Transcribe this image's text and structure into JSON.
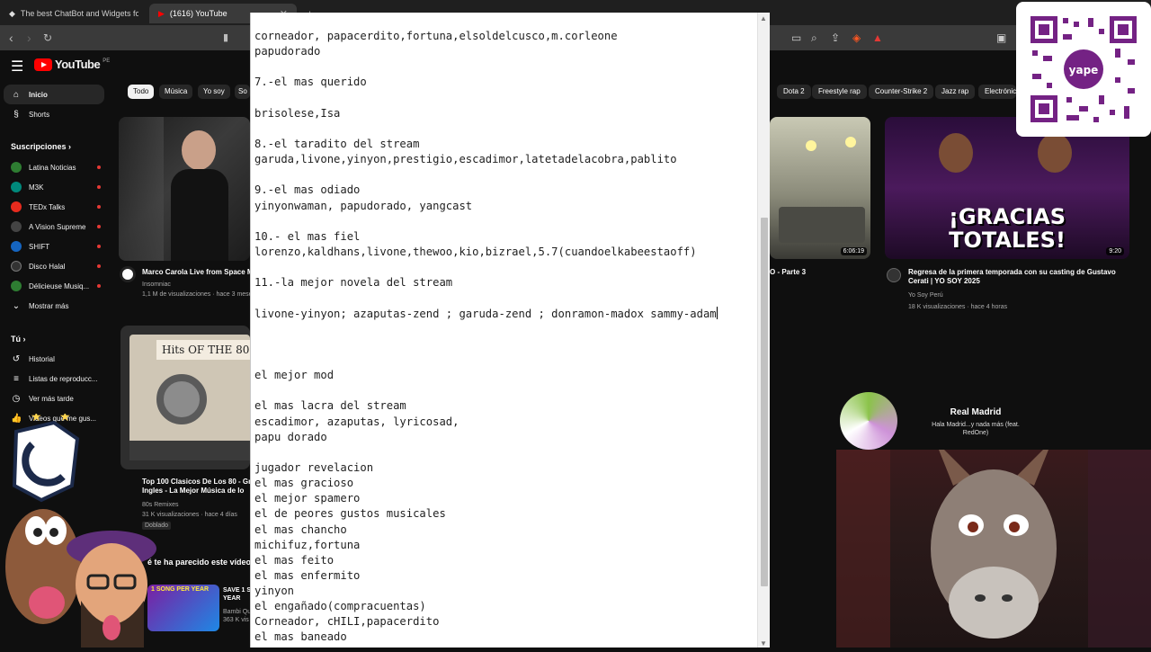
{
  "browser": {
    "tabs": [
      {
        "title": "The best ChatBot and Widgets for Ki",
        "active": false
      },
      {
        "title": "(1616) YouTube",
        "active": true
      }
    ],
    "new_tab": "+"
  },
  "youtube": {
    "logo_text": "YouTube",
    "logo_country": "PE",
    "sidebar": {
      "main": [
        {
          "label": "Inicio",
          "icon": "home-icon",
          "active": true
        },
        {
          "label": "Shorts",
          "icon": "shorts-icon",
          "active": false
        }
      ],
      "subscriptions_title": "Suscripciones",
      "subscriptions": [
        {
          "label": "Latina Noticias",
          "color": "#2e7d32"
        },
        {
          "label": "M3K",
          "color": "#00897b"
        },
        {
          "label": "TEDx Talks",
          "color": "#e62b1e"
        },
        {
          "label": "A Vision Supreme",
          "color": "#444444"
        },
        {
          "label": "SHIFT",
          "color": "#1565c0"
        },
        {
          "label": "Disco Halal",
          "color": "#333333"
        },
        {
          "label": "Délicieuse Musiq...",
          "color": "#2e7d32"
        }
      ],
      "show_more": "Mostrar más",
      "you_title": "Tú",
      "you_items": [
        {
          "label": "Historial",
          "icon": "history-icon"
        },
        {
          "label": "Listas de reproducc...",
          "icon": "playlist-icon"
        },
        {
          "label": "Ver más tarde",
          "icon": "clock-icon"
        },
        {
          "label": "Videos que me gus...",
          "icon": "thumbs-up-icon"
        }
      ]
    },
    "chips_left": [
      "Todo",
      "Música",
      "Yo soy",
      "So"
    ],
    "chips_right": [
      "Dota 2",
      "Freestyle rap",
      "Counter-Strike 2",
      "Jazz rap",
      "Electrónic"
    ],
    "videos": [
      {
        "title": "Marco Carola Live from Space M",
        "channel": "Insomniac",
        "meta": "1,1 M de visualizaciones · hace 3 meses"
      },
      {
        "title": "Top 100 Clasicos De Los 80 - Gr\nIngles - La Mejor Música de lo",
        "channel": "80s Remixes",
        "meta": "31 K visualizaciones · hace 4 días",
        "badge": "Doblado"
      },
      {
        "title": "é te ha parecido este vídeo",
        "channel": "",
        "meta": ""
      },
      {
        "title": "O - Parte 3",
        "channel": "",
        "meta": "",
        "duration": "6:06:19"
      },
      {
        "title": "Regresa de la primera temporada con su casting de Gustavo\nCerati | YO SOY 2025",
        "channel": "Yo Soy Perú",
        "meta": "18 K visualizaciones · hace 4 horas",
        "duration": "9:20",
        "overlay_text": "¡GRACIAS\nTOTALES!"
      }
    ],
    "song_card": {
      "label": "1 SONG PER YEAR",
      "sub": "SAVE 1 S\nYEAR",
      "meta": "Bambi Qui\n363 K vis"
    },
    "cassette_label": "Hits OF THE 80"
  },
  "editor": {
    "lines": [
      "corneador, papacerdito,fortuna,elsoldelcusco,m.corleone",
      "papudorado",
      "",
      "7.-el mas querido",
      "",
      "brisolese,Isa",
      "",
      "8.-el taradito del stream",
      "garuda,livone,yinyon,prestigio,escadimor,latetadelacobra,pablito",
      "",
      "9.-el mas odiado",
      "yinyonwaman, papudorado, yangcast",
      "",
      "10.- el mas fiel",
      "lorenzo,kaldhans,livone,thewoo,kio,bizrael,5.7(cuandoelkabeestaoff)",
      "",
      "11.-la mejor novela del stream",
      "",
      "livone-yinyon; azaputas-zend ; garuda-zend ; donramon-madox sammy-adam",
      "",
      "",
      "",
      "el mejor mod",
      "",
      "el mas lacra del stream",
      "escadimor, azaputas, lyricosad,",
      "papu dorado",
      "",
      "jugador revelacion",
      "el mas gracioso",
      "el mejor spamero",
      "el de peores gustos musicales",
      "el mas chancho",
      "michifuz,fortuna",
      "el mas feito",
      "el mas enfermito",
      "yinyon",
      "el engañado(compracuentas)",
      "Corneador, cHILI,papacerdito",
      "el mas baneado"
    ]
  },
  "now_playing": {
    "title": "Real Madrid",
    "subtitle": "Hala Madrid...y nada más (feat.\nRedOne)"
  },
  "qr": {
    "brand": "yape"
  },
  "colors": {
    "yt_red": "#ff0000",
    "yape_purple": "#742284",
    "accent_blue": "#3ea6ff"
  }
}
